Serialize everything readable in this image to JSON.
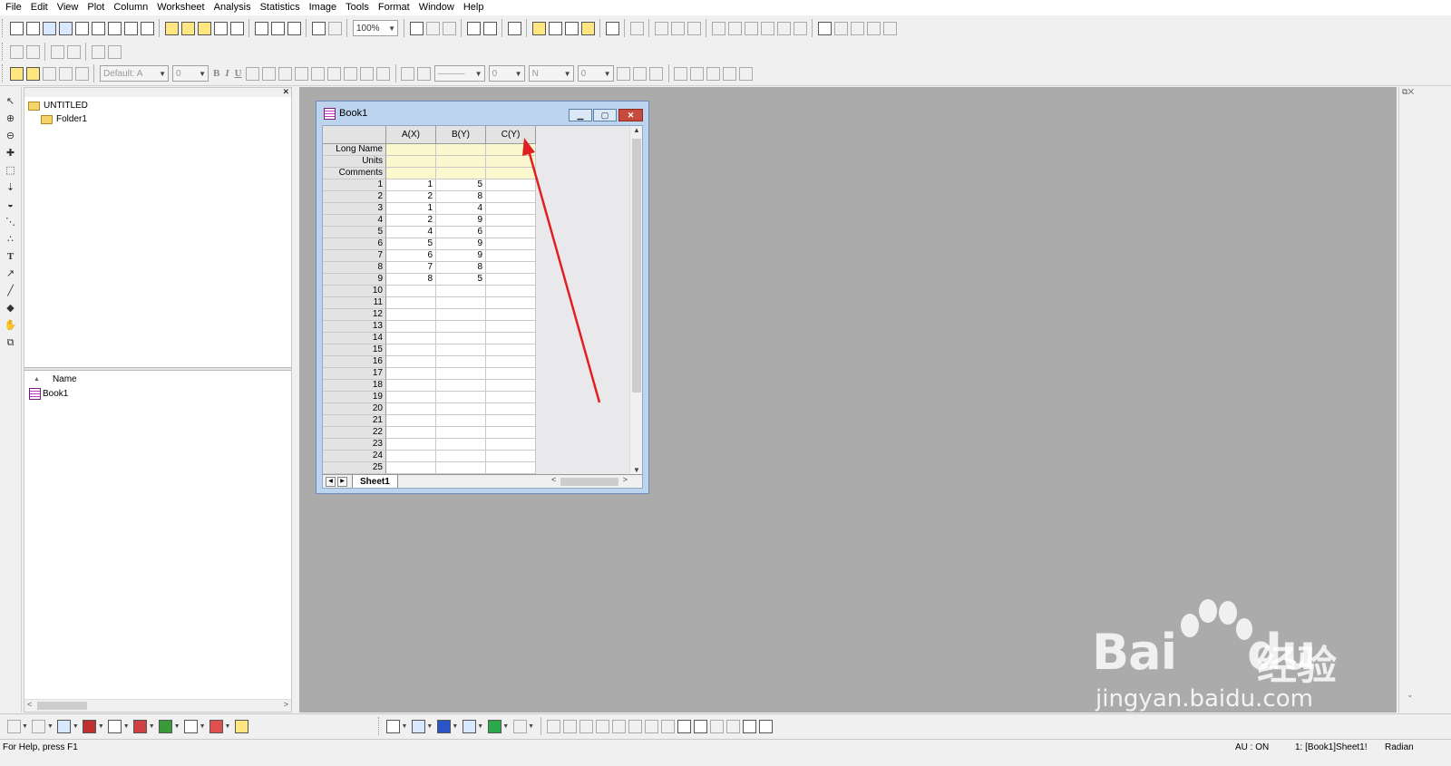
{
  "menu": [
    "File",
    "Edit",
    "View",
    "Plot",
    "Column",
    "Worksheet",
    "Analysis",
    "Statistics",
    "Image",
    "Tools",
    "Format",
    "Window",
    "Help"
  ],
  "toolbar": {
    "zoom": "100%",
    "font_name": "Default: A",
    "font_size": "0",
    "bold_glyph": "B",
    "italic_glyph": "I",
    "underline_glyph": "U",
    "line_size": "0",
    "fill_label": "N",
    "pattern_size": "0"
  },
  "explorer": {
    "root_folder": "UNTITLED",
    "sub_folder": "Folder1",
    "list_header": "Name",
    "items": [
      "Book1"
    ]
  },
  "workbook": {
    "title": "Book1",
    "columns": [
      "A(X)",
      "B(Y)",
      "C(Y)"
    ],
    "meta_rows": [
      "Long Name",
      "Units",
      "Comments"
    ],
    "rows": [
      {
        "n": "1",
        "a": "1",
        "b": "5",
        "c": ""
      },
      {
        "n": "2",
        "a": "2",
        "b": "8",
        "c": ""
      },
      {
        "n": "3",
        "a": "1",
        "b": "4",
        "c": ""
      },
      {
        "n": "4",
        "a": "2",
        "b": "9",
        "c": ""
      },
      {
        "n": "5",
        "a": "4",
        "b": "6",
        "c": ""
      },
      {
        "n": "6",
        "a": "5",
        "b": "9",
        "c": ""
      },
      {
        "n": "7",
        "a": "6",
        "b": "9",
        "c": ""
      },
      {
        "n": "8",
        "a": "7",
        "b": "8",
        "c": ""
      },
      {
        "n": "9",
        "a": "8",
        "b": "5",
        "c": ""
      },
      {
        "n": "10",
        "a": "",
        "b": "",
        "c": ""
      },
      {
        "n": "11",
        "a": "",
        "b": "",
        "c": ""
      },
      {
        "n": "12",
        "a": "",
        "b": "",
        "c": ""
      },
      {
        "n": "13",
        "a": "",
        "b": "",
        "c": ""
      },
      {
        "n": "14",
        "a": "",
        "b": "",
        "c": ""
      },
      {
        "n": "15",
        "a": "",
        "b": "",
        "c": ""
      },
      {
        "n": "16",
        "a": "",
        "b": "",
        "c": ""
      },
      {
        "n": "17",
        "a": "",
        "b": "",
        "c": ""
      },
      {
        "n": "18",
        "a": "",
        "b": "",
        "c": ""
      },
      {
        "n": "19",
        "a": "",
        "b": "",
        "c": ""
      },
      {
        "n": "20",
        "a": "",
        "b": "",
        "c": ""
      },
      {
        "n": "21",
        "a": "",
        "b": "",
        "c": ""
      },
      {
        "n": "22",
        "a": "",
        "b": "",
        "c": ""
      },
      {
        "n": "23",
        "a": "",
        "b": "",
        "c": ""
      },
      {
        "n": "24",
        "a": "",
        "b": "",
        "c": ""
      },
      {
        "n": "25",
        "a": "",
        "b": "",
        "c": ""
      }
    ],
    "sheet_tab": "Sheet1"
  },
  "status": {
    "help": "For Help, press F1",
    "au": "AU : ON",
    "active": "1: [Book1]Sheet1!",
    "angle": "Radian"
  },
  "watermark": {
    "logo": "Bai",
    "logo_suffix": "du",
    "chinese": "经验",
    "url": "jingyan.baidu.com"
  },
  "colors": {
    "annotation_arrow": "#e02020",
    "workspace": "#ababab",
    "metadata_row": "#fbf7cf"
  }
}
